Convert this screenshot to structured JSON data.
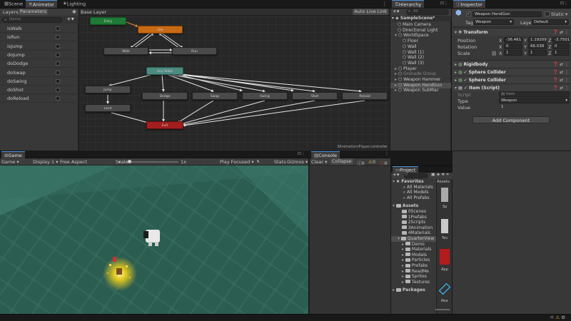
{
  "top_tabs": {
    "scene": "Scene",
    "animator": "Animator",
    "lighting": "Lighting"
  },
  "animator": {
    "layers_tab": "Layers",
    "parameters_tab": "Parameters",
    "search_placeholder": "Name",
    "layer_title": "Base Layer",
    "auto_live_link": "Auto Live Link",
    "footer_path": "3Animation/Player.controller",
    "parameters": [
      "isWalk",
      "isRun",
      "isJump",
      "doJump",
      "doDodge",
      "doSwap",
      "doSwing",
      "doShot",
      "doReload"
    ],
    "nodes": {
      "entry": "Entry",
      "idle": "Idle",
      "walk": "Walk",
      "run": "Run",
      "any_state": "Any State",
      "jump": "Jump",
      "land": "Land",
      "dodge": "Dodge",
      "swap": "Swap",
      "swing": "Swing",
      "shot": "Shot",
      "reload": "Reload",
      "exit": "Exit"
    }
  },
  "hierarchy": {
    "tab": "Hierarchy",
    "search_placeholder": "All",
    "scene": "SampleScene*",
    "items": [
      "Main Camera",
      "Directional Light",
      "WorldSpace",
      "Floor",
      "Wall",
      "Wall (1)",
      "Wall (2)",
      "Wall (3)",
      "Player",
      "Grenade Group",
      "Weapon Hammer",
      "Weapon HandGun",
      "Weapon SubMac"
    ]
  },
  "inspector": {
    "tab": "Inspector",
    "object_name": "Weapon HandGun",
    "static_label": "Static",
    "tag_label": "Tag",
    "tag_value": "Weapon",
    "layer_label": "Layer",
    "layer_value": "Default",
    "transform": {
      "title": "Transform",
      "position_label": "Position",
      "rotation_label": "Rotation",
      "scale_label": "Scale",
      "position": {
        "x": "-36.461",
        "y": "1.19209",
        "z": "-3.7501"
      },
      "rotation": {
        "x": "0",
        "y": "66.038",
        "z": "0"
      },
      "scale": {
        "x": "1",
        "y": "1",
        "z": "1"
      }
    },
    "components": [
      "Rigidbody",
      "Sphere Collider",
      "Sphere Collider",
      "Item (Script)"
    ],
    "script_label": "Script",
    "script_value": "Item",
    "type_label": "Type",
    "type_value": "Weapon",
    "value_label": "Value",
    "value_value": "1",
    "add_component": "Add Component"
  },
  "game": {
    "tab": "Game",
    "mode": "Game",
    "display": "Display 1",
    "aspect": "Free Aspect",
    "scale_label": "Scale",
    "scale_value": "1x",
    "play_focused": "Play Focused",
    "stats": "Stats",
    "gizmos": "Gizmos"
  },
  "console": {
    "tab": "Console",
    "clear": "Clear",
    "collapse": "Collapse",
    "count_log": "0",
    "count_warn": "0",
    "count_err": "0"
  },
  "project": {
    "tab": "Project",
    "favorites": "Favorites",
    "favorite_items": [
      "All Materials",
      "All Models",
      "All Prefabs"
    ],
    "assets": "Assets",
    "asset_items": [
      "0Scenes",
      "1Prefabs",
      "2Scripts",
      "3Animation",
      "4Materials",
      "QuarterView 3"
    ],
    "quarter_items": [
      "Demo",
      "Materials",
      "Models",
      "Particles",
      "Prefabs",
      "ReadMe",
      "Sprites",
      "Textures"
    ],
    "packages": "Packages",
    "grid_header": "Assets",
    "thumb_labels": [
      "Sp",
      "Tex",
      "App",
      "Rea"
    ]
  },
  "colors": {
    "accent": "#4a90d9",
    "entry": "#1f7a35",
    "idle": "#c76a14",
    "any_state": "#4d8a7f",
    "exit": "#a31e1e",
    "floor": "#2f6155"
  }
}
